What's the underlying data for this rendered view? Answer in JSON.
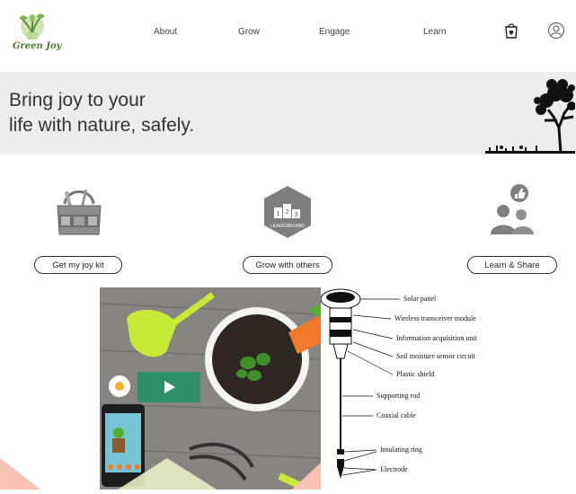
{
  "brand": {
    "name": "Green Joy"
  },
  "nav": {
    "items": [
      "About",
      "Grow",
      "Engage",
      "Learn"
    ]
  },
  "icons": {
    "cart": "cart-icon",
    "user": "user-icon"
  },
  "hero": {
    "line1": "Bring joy to your",
    "line2": "life with nature, safely."
  },
  "features": [
    {
      "icon": "gardening-bag-icon",
      "button": "Get my joy kit"
    },
    {
      "icon": "leaderboard-icon",
      "button": "Grow with others",
      "badge": [
        "1",
        "2",
        "3"
      ],
      "badge_label": "LEADERBOARD"
    },
    {
      "icon": "community-like-icon",
      "button": "Learn & Share"
    }
  ],
  "diagram": {
    "labels": [
      "Solar panel",
      "Wireless   transceiver   module",
      "Information acquisition unit",
      "Soil moisture sensor circuit",
      "Plastic shield",
      "Supporting rod",
      "Coaxial cable",
      "Insulating ring",
      "Electrode"
    ]
  },
  "colors": {
    "accent": "#2f8f6f",
    "hero_bg": "#ededed",
    "play_button": "#2e8f6a"
  }
}
